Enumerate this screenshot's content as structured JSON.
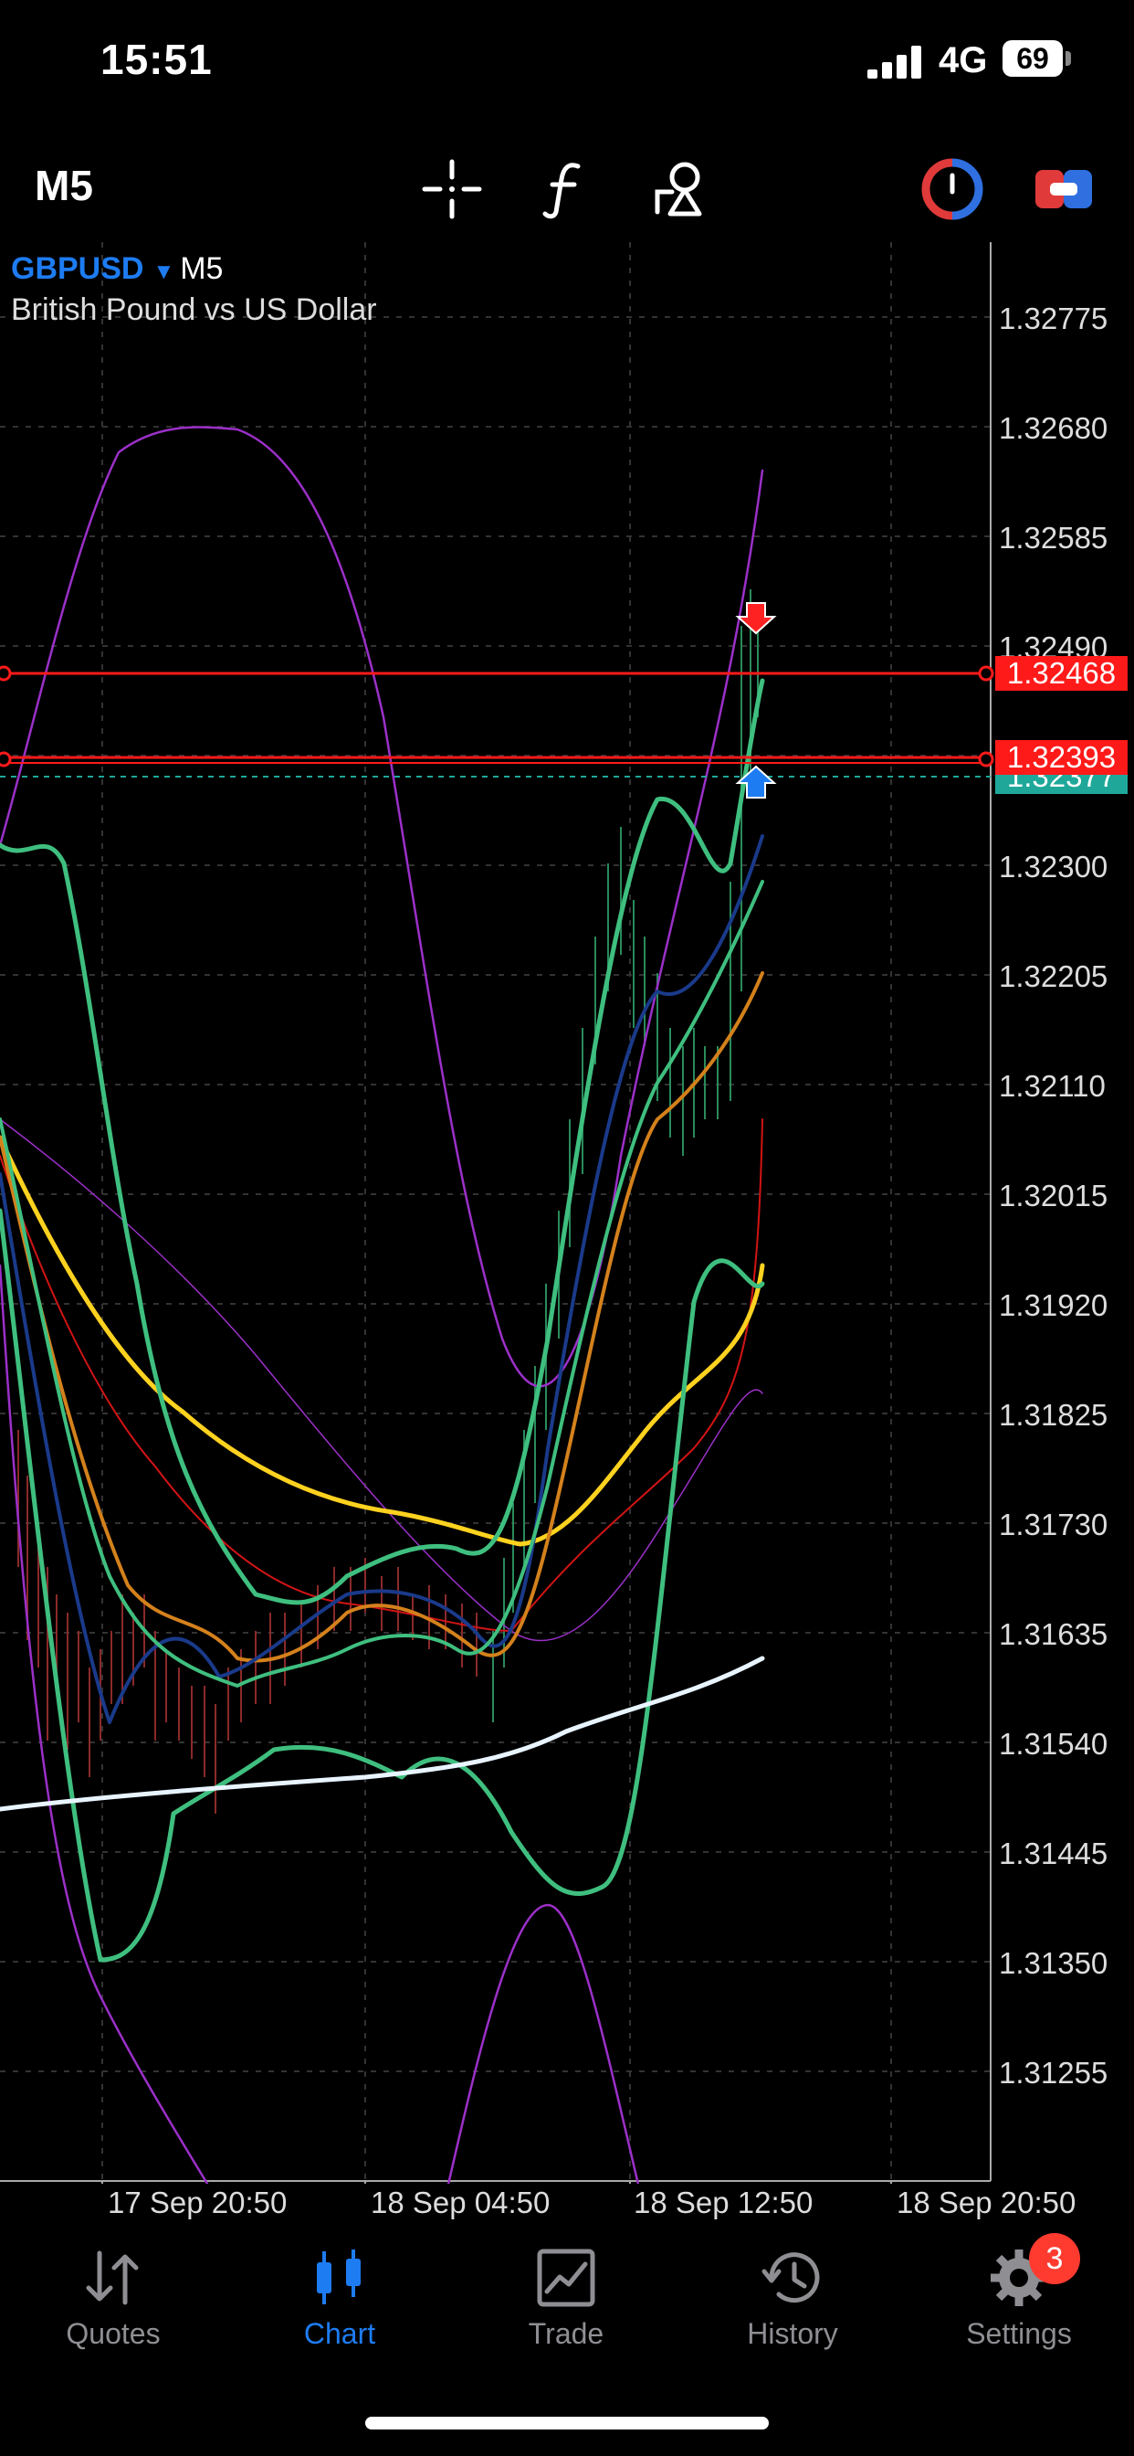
{
  "status_bar": {
    "time": "15:51",
    "network": "4G",
    "battery": "69"
  },
  "toolbar": {
    "timeframe": "M5",
    "icons": [
      "crosshair-icon",
      "function-icon",
      "objects-icon",
      "one-click-trading-icon",
      "trade-levels-icon"
    ]
  },
  "chart": {
    "symbol": "GBPUSD",
    "timeframe": "M5",
    "description": "British Pound vs US Dollar",
    "price_axis": [
      "1.32775",
      "1.32680",
      "1.32585",
      "1.32490",
      "1.32300",
      "1.32205",
      "1.32110",
      "1.32015",
      "1.31920",
      "1.31825",
      "1.31730",
      "1.31635",
      "1.31540",
      "1.31445",
      "1.31350",
      "1.31255"
    ],
    "levels": [
      {
        "name": "order-level-sell",
        "price": "1.32468",
        "color": "#ff1a1a"
      },
      {
        "name": "order-level-buy",
        "price": "1.32393",
        "color": "#ff1a1a"
      },
      {
        "name": "bid-line",
        "price": "1.32377",
        "color": "#1fa89a"
      }
    ],
    "time_axis": [
      "17 Sep 20:50",
      "18 Sep 04:50",
      "18 Sep 12:50",
      "18 Sep 20:50"
    ],
    "indicator_colors": {
      "green": "#3fbf7f",
      "navy": "#1a3a8a",
      "orange": "#d4811c",
      "yellow": "#ffd21f",
      "red": "#d21414",
      "purple": "#9b30c8",
      "white": "#e8f4ff"
    }
  },
  "tabs": [
    {
      "id": "quotes",
      "label": "Quotes",
      "icon": "quotes-icon",
      "active": false
    },
    {
      "id": "chart",
      "label": "Chart",
      "icon": "chart-icon",
      "active": true
    },
    {
      "id": "trade",
      "label": "Trade",
      "icon": "trade-icon",
      "active": false
    },
    {
      "id": "history",
      "label": "History",
      "icon": "history-icon",
      "active": false
    },
    {
      "id": "settings",
      "label": "Settings",
      "icon": "gear-icon",
      "active": false,
      "badge": "3"
    }
  ]
}
